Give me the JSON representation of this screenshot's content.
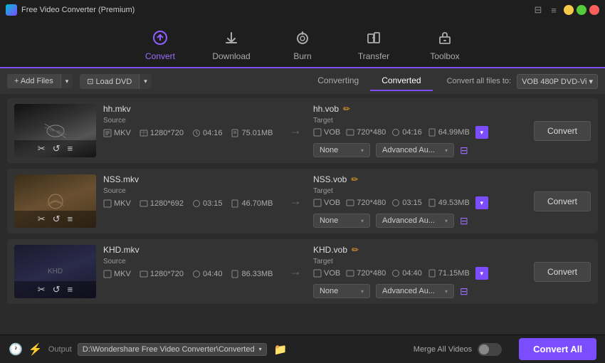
{
  "app": {
    "title": "Free Video Converter (Premium)",
    "icon": "▶"
  },
  "titlebar": {
    "minimize": "−",
    "maximize": "□",
    "close": "✕",
    "menu1": "≡",
    "menu2": "⊟"
  },
  "nav": {
    "items": [
      {
        "id": "convert",
        "label": "Convert",
        "icon": "↻",
        "active": true
      },
      {
        "id": "download",
        "label": "Download",
        "icon": "↓",
        "active": false
      },
      {
        "id": "burn",
        "label": "Burn",
        "icon": "⊙",
        "active": false
      },
      {
        "id": "transfer",
        "label": "Transfer",
        "icon": "⇄",
        "active": false
      },
      {
        "id": "toolbox",
        "label": "Toolbox",
        "icon": "⚙",
        "active": false
      }
    ]
  },
  "toolbar": {
    "add_files": "+ Add Files",
    "load_dvd": "⊡ Load DVD",
    "converting_tab": "Converting",
    "converted_tab": "Converted",
    "convert_all_to": "Convert all files to:",
    "format_select": "VOB 480P DVD-Vi"
  },
  "files": [
    {
      "id": "file1",
      "source_name": "hh.mkv",
      "target_name": "hh.vob",
      "source_format": "MKV",
      "source_res": "1280*720",
      "source_dur": "04:16",
      "source_size": "75.01MB",
      "target_format": "VOB",
      "target_res": "720*480",
      "target_dur": "04:16",
      "target_size": "64.99MB",
      "subtitle": "None",
      "advanced": "Advanced Au...",
      "convert_btn": "Convert",
      "thumb_class": "thumb-img-1"
    },
    {
      "id": "file2",
      "source_name": "NSS.mkv",
      "target_name": "NSS.vob",
      "source_format": "MKV",
      "source_res": "1280*692",
      "source_dur": "03:15",
      "source_size": "46.70MB",
      "target_format": "VOB",
      "target_res": "720*480",
      "target_dur": "03:15",
      "target_size": "49.53MB",
      "subtitle": "None",
      "advanced": "Advanced Au...",
      "convert_btn": "Convert",
      "thumb_class": "thumb-img-2"
    },
    {
      "id": "file3",
      "source_name": "KHD.mkv",
      "target_name": "KHD.vob",
      "source_format": "MKV",
      "source_res": "1280*720",
      "source_dur": "04:40",
      "source_size": "86.33MB",
      "target_format": "VOB",
      "target_res": "720*480",
      "target_dur": "04:40",
      "target_size": "71.15MB",
      "subtitle": "None",
      "advanced": "Advanced Au...",
      "convert_btn": "Convert",
      "thumb_class": "thumb-img-3"
    }
  ],
  "bottom": {
    "output_label": "Output",
    "output_path": "D:\\Wondershare Free Video Converter\\Converted",
    "merge_label": "Merge All Videos",
    "convert_all": "Convert All"
  },
  "icons": {
    "cut": "✂",
    "rotate": "↺",
    "settings": "≡",
    "edit": "✏",
    "clock": "🕐",
    "bolt": "⚡",
    "folder": "📁",
    "dropdown": "▾",
    "eq": "⊟",
    "arrow_right": "→"
  }
}
